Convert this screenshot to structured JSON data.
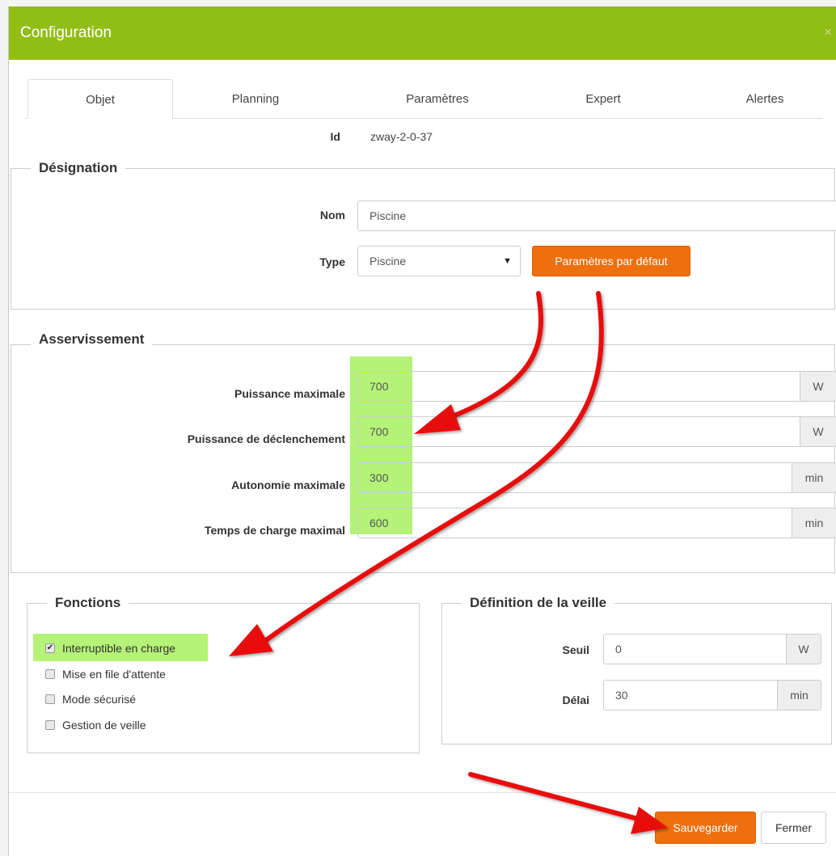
{
  "header": {
    "title": "Configuration",
    "close": "×"
  },
  "tabs": [
    "Objet",
    "Planning",
    "Paramètres",
    "Expert",
    "Alertes"
  ],
  "id_row": {
    "label": "Id",
    "value": "zway-2-0-37"
  },
  "designation": {
    "legend": "Désignation",
    "nom_label": "Nom",
    "nom_value": "Piscine",
    "type_label": "Type",
    "type_value": "Piscine",
    "default_button": "Paramètres par défaut"
  },
  "asservissement": {
    "legend": "Asservissement",
    "rows": [
      {
        "label": "Puissance maximale",
        "value": "700",
        "unit": "W"
      },
      {
        "label": "Puissance de déclenchement",
        "value": "700",
        "unit": "W"
      },
      {
        "label": "Autonomie maximale",
        "value": "300",
        "unit": "min"
      },
      {
        "label": "Temps de charge maximal",
        "value": "600",
        "unit": "min"
      }
    ]
  },
  "fonctions": {
    "legend": "Fonctions",
    "items": [
      {
        "label": "Interruptible en charge",
        "checked": true
      },
      {
        "label": "Mise en file d'attente",
        "checked": false
      },
      {
        "label": "Mode sécurisé",
        "checked": false
      },
      {
        "label": "Gestion de veille",
        "checked": false
      }
    ]
  },
  "veille": {
    "legend": "Définition de la veille",
    "seuil_label": "Seuil",
    "seuil_value": "0",
    "seuil_unit": "W",
    "delai_label": "Délai",
    "delai_value": "30",
    "delai_unit": "min"
  },
  "footer": {
    "save": "Sauvegarder",
    "close": "Fermer"
  },
  "colors": {
    "header": "#92bd16",
    "accent": "#ee6f0e",
    "highlight": "#a8f060",
    "arrow": "#e81010"
  }
}
